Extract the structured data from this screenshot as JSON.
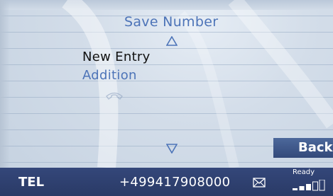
{
  "header": {
    "title": "Save Number"
  },
  "menu": {
    "scroll_up_icon": "triangle-up-outline",
    "items": [
      "New Entry",
      "Addition"
    ],
    "handset_icon": "phone-handset",
    "scroll_down_icon": "triangle-down-outline"
  },
  "buttons": {
    "back_label": "Back"
  },
  "status_bar": {
    "mode_label": "TEL",
    "phone_number": "+499417908000",
    "message_icon": "envelope",
    "status_text": "Ready",
    "signal_bars_filled": 3,
    "signal_bars_total": 5
  },
  "colors": {
    "accent_text": "#4d74b8",
    "background": "#cfdae8",
    "status_bar": "#2e3f6e",
    "button": "#3d5589"
  }
}
